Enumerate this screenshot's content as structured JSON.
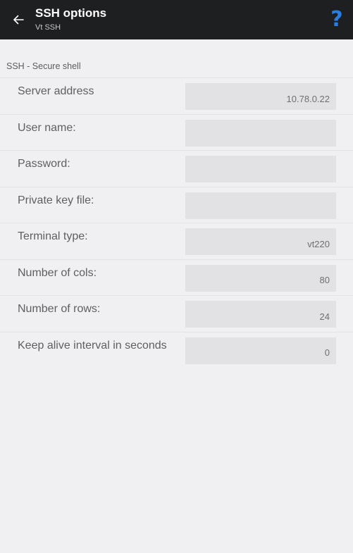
{
  "app_bar": {
    "title": "SSH options",
    "subtitle": "Vt SSH",
    "back_icon": "arrow-left-icon",
    "help_icon": "question-mark-icon",
    "help_label": "?",
    "background": "#1e1f20",
    "help_color": "#2a7de1"
  },
  "section": {
    "header": "SSH - Secure shell"
  },
  "settings": [
    {
      "label": "Server address",
      "value": "10.78.0.22"
    },
    {
      "label": "User name:",
      "value": ""
    },
    {
      "label": "Password:",
      "value": ""
    },
    {
      "label": "Private key file:",
      "value": ""
    },
    {
      "label": "Terminal type:",
      "value": "vt220"
    },
    {
      "label": "Number of cols:",
      "value": "80"
    },
    {
      "label": "Number of rows:",
      "value": "24"
    },
    {
      "label": "Keep alive interval in seconds",
      "value": "0"
    }
  ]
}
